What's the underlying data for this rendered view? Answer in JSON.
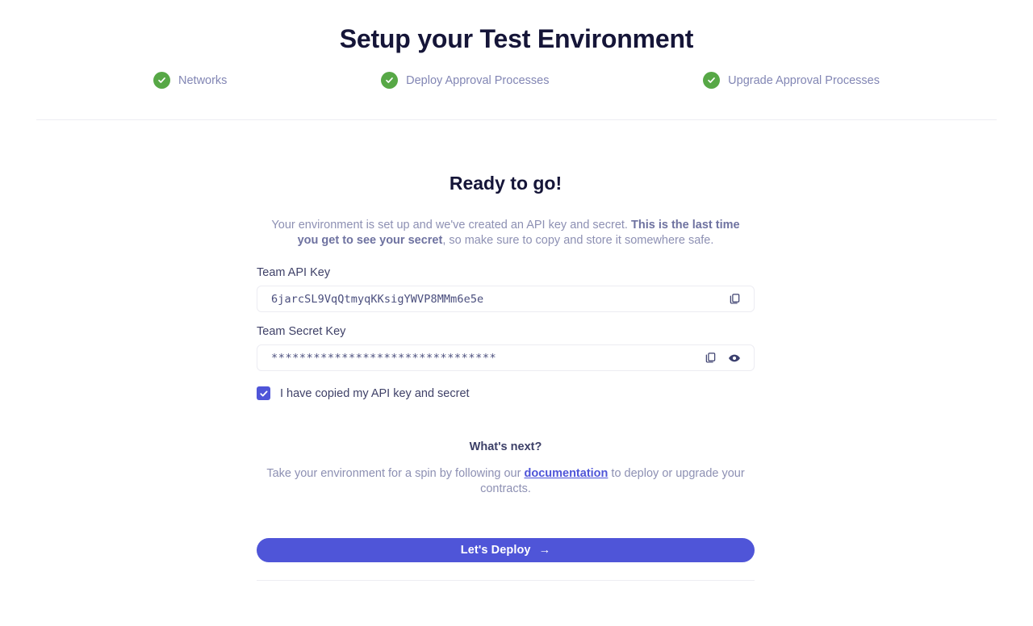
{
  "header": {
    "title": "Setup your Test Environment",
    "steps": [
      {
        "label": "Networks",
        "icon": "check-circle-icon",
        "complete": true
      },
      {
        "label": "Deploy Approval Processes",
        "icon": "check-circle-icon",
        "complete": true
      },
      {
        "label": "Upgrade Approval Processes",
        "icon": "check-circle-icon",
        "complete": true
      }
    ]
  },
  "card": {
    "title": "Ready to go!",
    "description_part1": "Your environment is set up and we've created an API key and secret. ",
    "description_bold": "This is the last time you get to see your secret",
    "description_part2": ", so make sure to copy and store it somewhere safe.",
    "api_key": {
      "label": "Team API Key",
      "value": "6jarcSL9VqQtmyqKKsigYWVP8MMm6e5e",
      "copy_icon": "copy-icon"
    },
    "secret_key": {
      "label": "Team Secret Key",
      "value": "********************************",
      "copy_icon": "copy-icon",
      "reveal_icon": "eye-icon"
    },
    "confirm_checkbox": {
      "label": "I have copied my API key and secret",
      "checked": true
    },
    "next": {
      "title": "What's next?",
      "text_part1": "Take your environment for a spin by following our ",
      "link_text": "documentation",
      "text_part2": " to deploy or upgrade your contracts."
    },
    "deploy_button": {
      "label": "Let's Deploy",
      "arrow": "→"
    }
  },
  "colors": {
    "accent": "#4f55d8",
    "success": "#57a846",
    "heading": "#151538",
    "muted": "#8d90b3"
  }
}
